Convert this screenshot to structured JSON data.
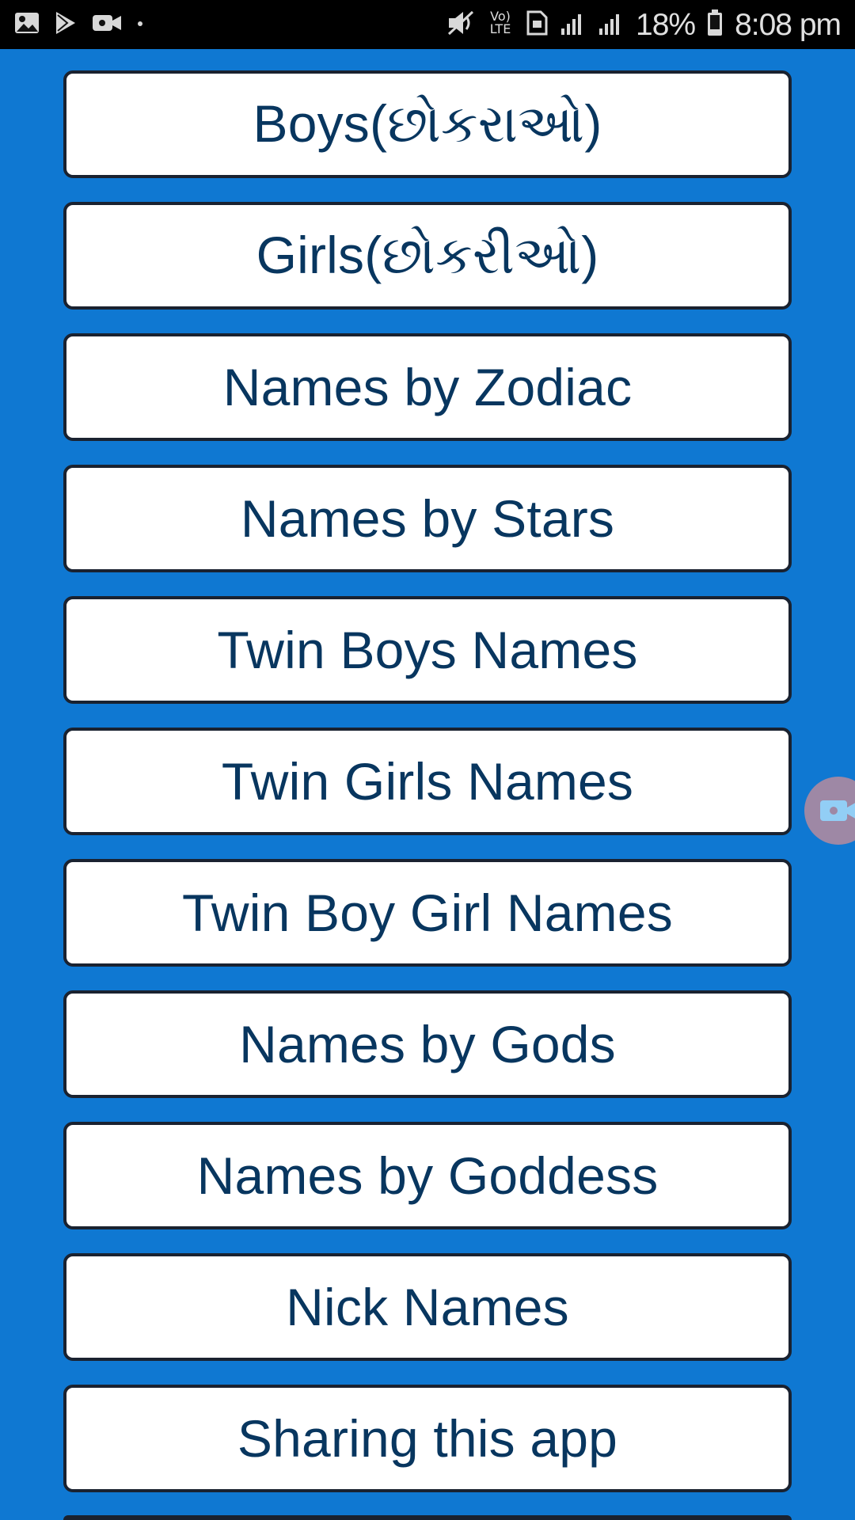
{
  "status_bar": {
    "time": "8:08 pm",
    "battery": "18%",
    "network": "LTE",
    "icons": [
      "gallery-icon",
      "play-store-icon",
      "video-camera-icon",
      "notification-dot-icon",
      "mute-icon",
      "volte-icon",
      "sim-icon",
      "signal-icon",
      "signal-icon-2",
      "battery-icon"
    ]
  },
  "menu": {
    "items": [
      {
        "label": "Boys(છોકરાઓ)"
      },
      {
        "label": "Girls(છોકરીઓ)"
      },
      {
        "label": "Names by Zodiac"
      },
      {
        "label": "Names by Stars"
      },
      {
        "label": "Twin Boys Names"
      },
      {
        "label": "Twin Girls Names"
      },
      {
        "label": "Twin Boy Girl Names"
      },
      {
        "label": "Names by Gods"
      },
      {
        "label": "Names by Goddess"
      },
      {
        "label": "Nick Names"
      },
      {
        "label": "Sharing this app"
      }
    ]
  },
  "floating_widget": {
    "icon": "video-camera-icon"
  },
  "colors": {
    "background": "#0f78d2",
    "status_bar": "#000000",
    "button_background": "#ffffff",
    "button_border": "#1a2230",
    "button_text": "#08365f"
  }
}
